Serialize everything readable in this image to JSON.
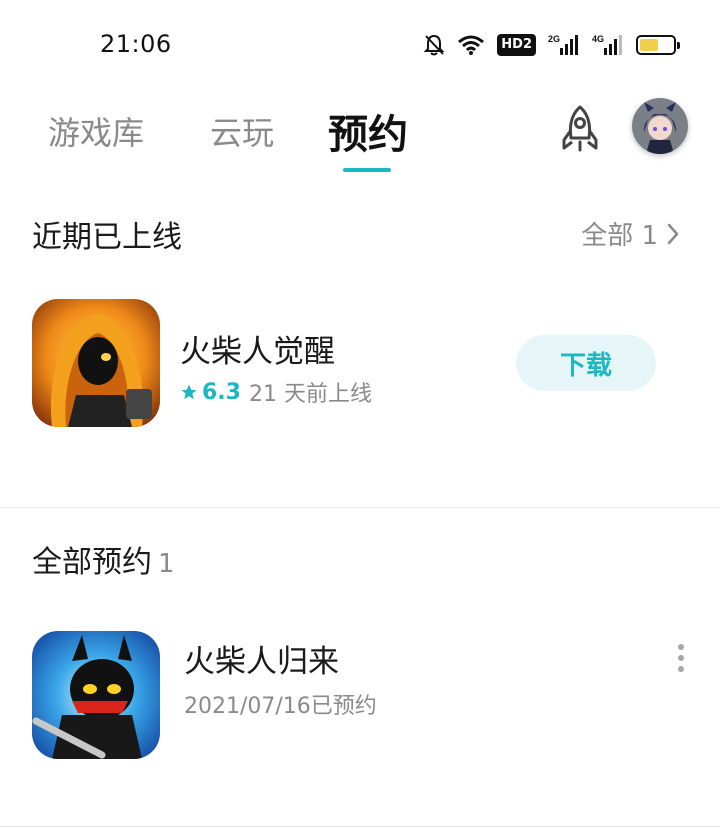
{
  "status_bar": {
    "time": "21:06",
    "hd_label": "HD2",
    "signal_1_label": "2G",
    "signal_2_label": "4G",
    "battery_level": 0.55,
    "icons": [
      "bell-muted-icon",
      "wifi-icon",
      "hd-icon",
      "signal-icon",
      "signal-icon",
      "battery-icon"
    ]
  },
  "tabs": [
    {
      "label": "游戏库"
    },
    {
      "label": "云玩"
    },
    {
      "label": "预约",
      "active": true
    }
  ],
  "header_icons": {
    "rocket": "rocket-icon",
    "avatar": "avatar-image"
  },
  "recent": {
    "title": "近期已上线",
    "view_all_label": "全部 1",
    "game": {
      "name": "火柴人觉醒",
      "rating": "6.3",
      "released": "21 天前上线",
      "action_label": "下载"
    }
  },
  "reservations": {
    "title": "全部预约",
    "count": "1",
    "game": {
      "name": "火柴人归来",
      "reserved_date": "2021/07/16已预约"
    }
  },
  "colors": {
    "accent": "#1ab8c4",
    "button_bg": "#e6f6f8",
    "secondary_text": "#8a8a8a"
  }
}
